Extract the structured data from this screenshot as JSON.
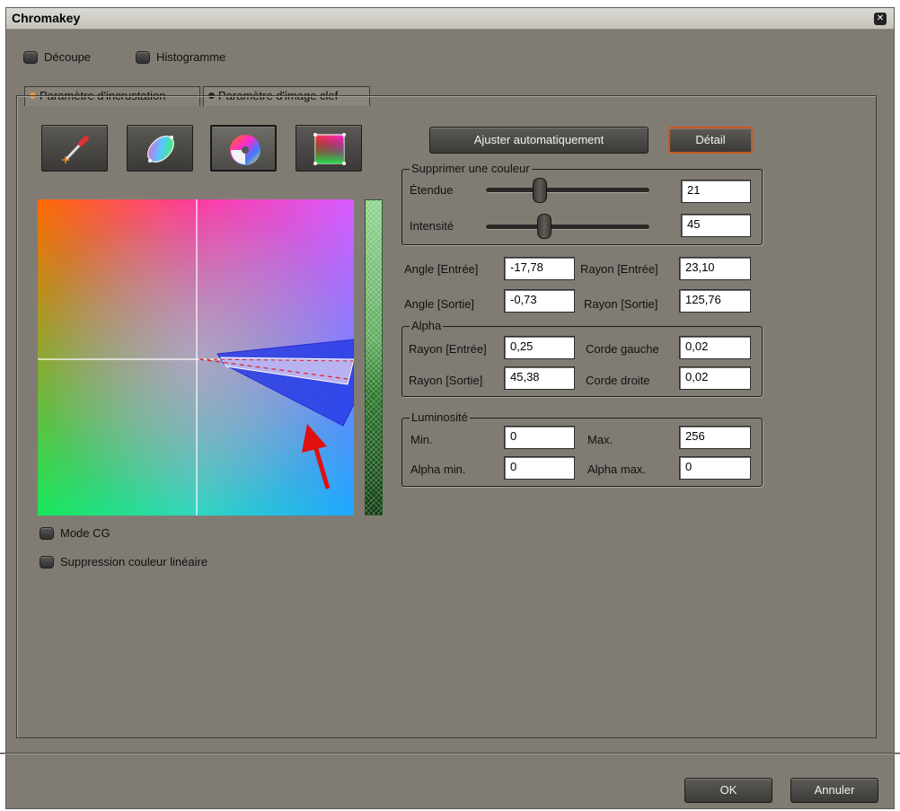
{
  "window": {
    "title": "Chromakey"
  },
  "top_options": [
    {
      "label": "Découpe"
    },
    {
      "label": "Histogramme"
    }
  ],
  "tabs": [
    {
      "label": "Paramètre d'incrustation",
      "dot_color": "#f39c34"
    },
    {
      "label": "Paramètre d'image clef",
      "dot_color": "#222222"
    }
  ],
  "tools": [
    {
      "icon": "eyedropper-icon"
    },
    {
      "icon": "color-ellipse-icon"
    },
    {
      "icon": "color-wheel-icon"
    },
    {
      "icon": "color-square-icon"
    }
  ],
  "bottom_options": [
    {
      "label": "Mode CG"
    },
    {
      "label": "Suppression couleur linéaire"
    }
  ],
  "actions": {
    "auto_adjust": "Ajuster automatiquement",
    "detail": "Détail"
  },
  "suppress": {
    "title": "Supprimer une couleur",
    "range_label": "Étendue",
    "range_value": "21",
    "intensity_label": "Intensité",
    "intensity_value": "45"
  },
  "angles": {
    "angle_in_label": "Angle [Entrée]",
    "angle_in_value": "-17,78",
    "radius_in_label": "Rayon [Entrée]",
    "radius_in_value": "23,10",
    "angle_out_label": "Angle [Sortie]",
    "angle_out_value": "-0,73",
    "radius_out_label": "Rayon [Sortie]",
    "radius_out_value": "125,76"
  },
  "alpha": {
    "title": "Alpha",
    "radius_in_label": "Rayon [Entrée]",
    "radius_in_value": "0,25",
    "chord_left_label": "Corde gauche",
    "chord_left_value": "0,02",
    "radius_out_label": "Rayon [Sortie]",
    "radius_out_value": "45,38",
    "chord_right_label": "Corde droite",
    "chord_right_value": "0,02"
  },
  "luminosity": {
    "title": "Luminosité",
    "min_label": "Min.",
    "min_value": "0",
    "max_label": "Max.",
    "max_value": "256",
    "alpha_min_label": "Alpha min.",
    "alpha_min_value": "0",
    "alpha_max_label": "Alpha max.",
    "alpha_max_value": "0"
  },
  "footer": {
    "ok": "OK",
    "cancel": "Annuler"
  },
  "colors": {
    "dialog_bg": "#807c74",
    "active_outline": "#c8571e",
    "arrow": "#e01010"
  }
}
